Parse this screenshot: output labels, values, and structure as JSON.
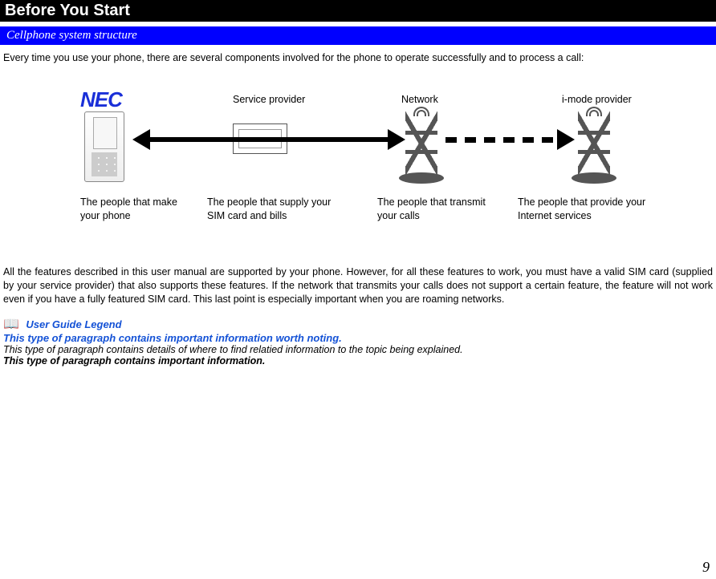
{
  "header": {
    "title": "Before You Start",
    "section": "Cellphone system structure"
  },
  "intro": "Every time you use your phone, there are several components involved for the phone to operate successfully and to process a call:",
  "diagram": {
    "brand": "NEC",
    "top_labels": {
      "service": "Service provider",
      "network": "Network",
      "imode": "i-mode  provider"
    },
    "bottom_labels": {
      "phone": "The people that make your phone",
      "service": "The people that supply your SIM card and bills",
      "network": "The people that transmit your calls",
      "imode": "The people that provide your Internet services"
    }
  },
  "para2": "All the features described in this user manual are supported by your phone. However, for all these features to work, you must have a valid SIM card (supplied by your service provider) that also supports these features. If the network that transmits your calls does not support a certain feature, the feature will not work even if you have a fully featured SIM card. This last point is especially important when you are roaming networks.",
  "legend": {
    "title": "User Guide Legend",
    "line1": "This type of paragraph contains important information worth noting.",
    "line2": "This type of paragraph contains details of where to find relatied information to the topic being explained.",
    "line3": "This type of paragraph contains important information."
  },
  "page_number": "9"
}
